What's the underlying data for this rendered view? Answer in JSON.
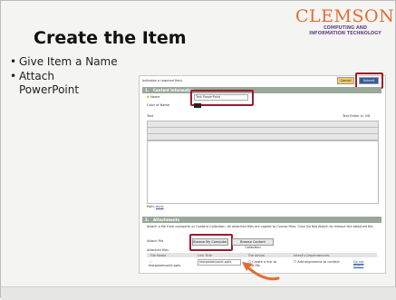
{
  "slide": {
    "title": "Create the Item",
    "bullets": [
      "Give Item a Name",
      "Attach PowerPoint"
    ],
    "logo_main": "CLEMSON",
    "logo_sub_1": "COMPUTING AND",
    "logo_sub_2": "INFORMATION TECHNOLOGY"
  },
  "screenshot": {
    "required_note": "Indicates a required field.",
    "cancel_label": "Cancel",
    "submit_label": "Submit",
    "section1": {
      "num": "1.",
      "label": "Content Information"
    },
    "name_label": "Name",
    "name_value": "Test PowerPoint",
    "color_label": "Color of Name",
    "text_label": "Text",
    "text_editor_label": "Text Editor is: ON",
    "path_label": "Path:",
    "section2": {
      "num": "2.",
      "label": "Attachments"
    },
    "attach_desc": "Attach a file from computer or Content Collection. All attached files are copied to Course Files. Click Do Not Attach to remove the attached file.",
    "attach_file_label": "Attach File",
    "browse_computer_label": "Browse My Computer",
    "browse_content_label": "Browse Content Collection",
    "attached_files_label": "Attached files",
    "columns": [
      "File Name",
      "Link Title",
      "File Action",
      "Intent's Dependencies"
    ],
    "file_name": "testpowerpoint.pptx",
    "link_title": "testpowerpoint.pptx",
    "file_action": "Create a link to this file",
    "dependency_text": "Add alignments to content",
    "do_not_attach": "Do not attach"
  },
  "colors": {
    "accent_red": "#9c1b2c",
    "arrow": "#e36c35",
    "logo": "#e36c35"
  }
}
